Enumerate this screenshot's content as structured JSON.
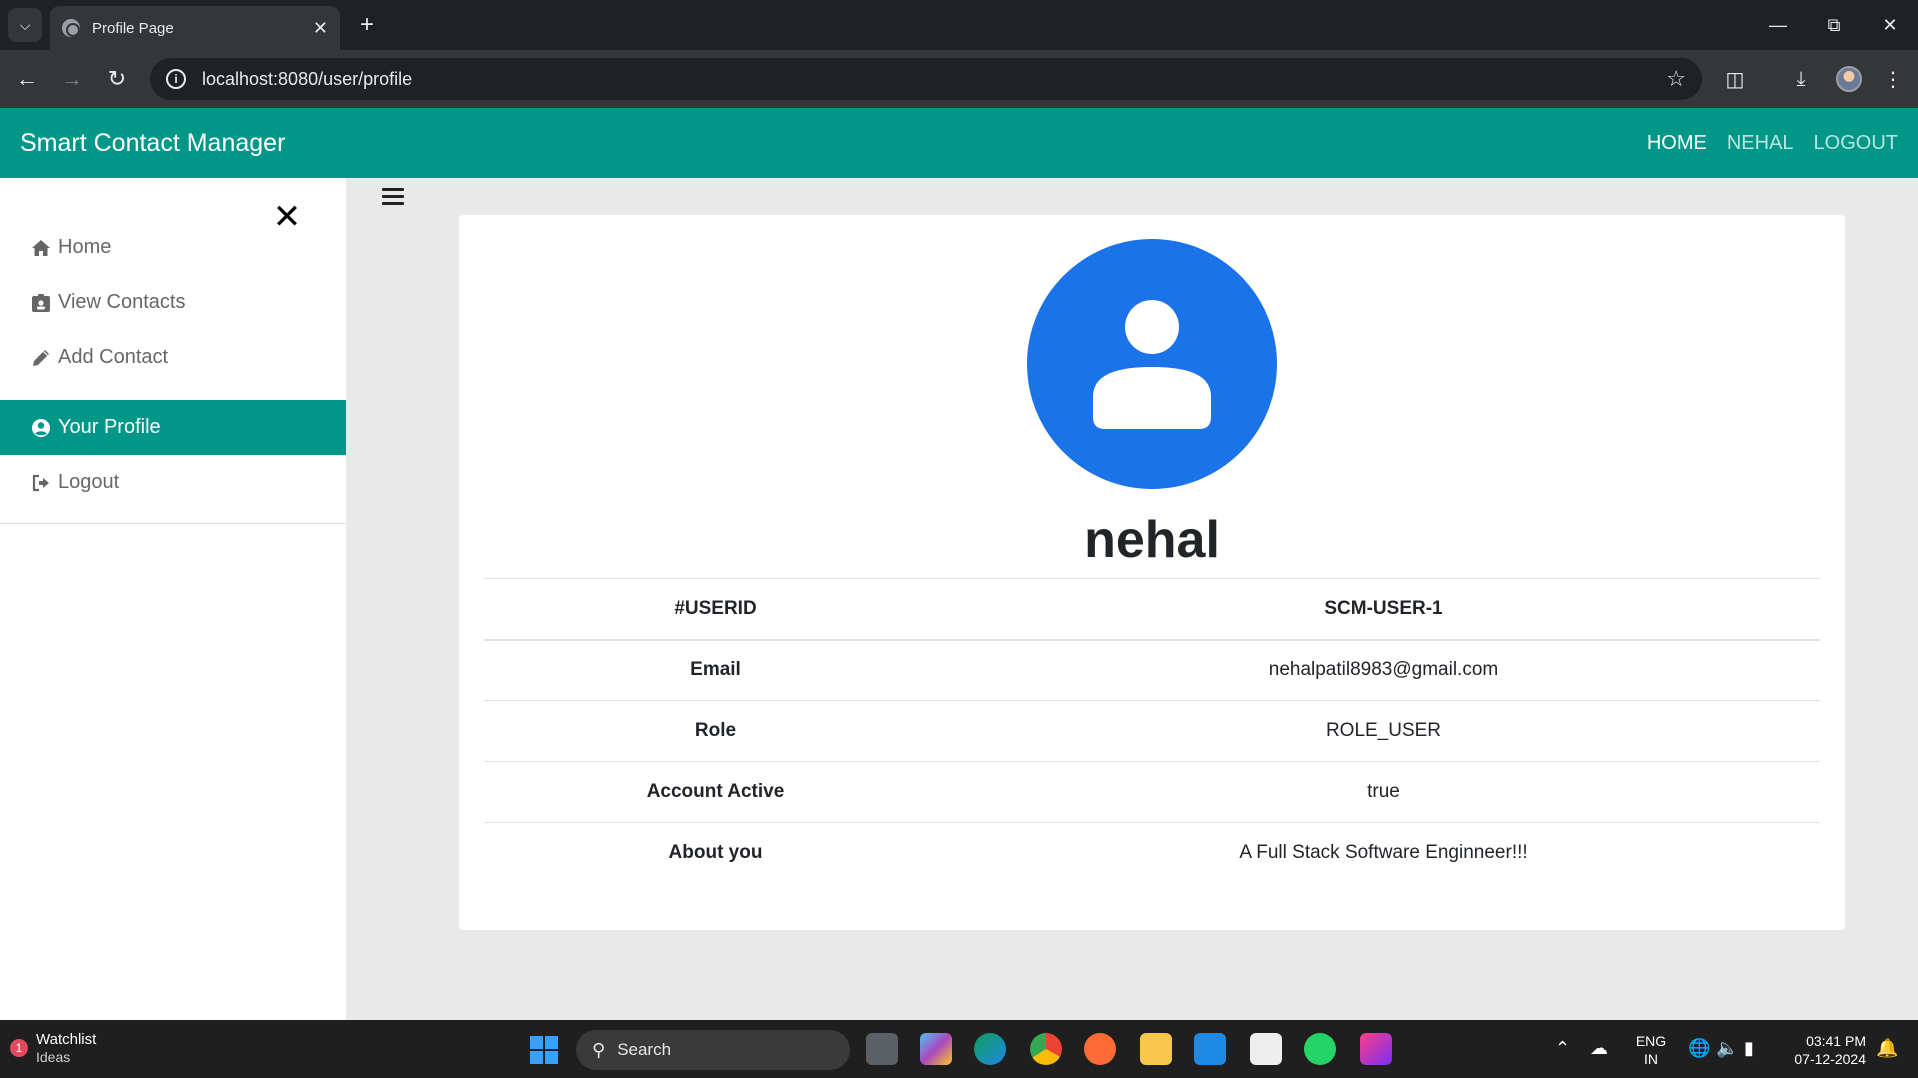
{
  "browser": {
    "tab_title": "Profile Page",
    "url": "localhost:8080/user/profile"
  },
  "app": {
    "brand": "Smart Contact Manager",
    "nav": [
      {
        "label": "HOME",
        "active": true
      },
      {
        "label": "NEHAL",
        "active": false
      },
      {
        "label": "LOGOUT",
        "active": false
      }
    ]
  },
  "sidebar": {
    "items": [
      {
        "label": "Home",
        "icon": "home-icon"
      },
      {
        "label": "View Contacts",
        "icon": "id-card-icon"
      },
      {
        "label": "Add Contact",
        "icon": "pencil-icon"
      },
      {
        "label": "Your Profile",
        "icon": "user-circle-icon",
        "active": true
      },
      {
        "label": "Logout",
        "icon": "sign-out-icon"
      }
    ]
  },
  "profile": {
    "name": "nehal",
    "rows": [
      {
        "key": "#USERID",
        "value": "SCM-USER-1"
      },
      {
        "key": "Email",
        "value": "nehalpatil8983@gmail.com"
      },
      {
        "key": "Role",
        "value": "ROLE_USER"
      },
      {
        "key": "Account Active",
        "value": "true"
      },
      {
        "key": "About you",
        "value": "A Full Stack Software Enginneer!!!"
      }
    ]
  },
  "taskbar": {
    "widget_badge": "1",
    "widget_title": "Watchlist",
    "widget_sub": "Ideas",
    "search_label": "Search",
    "lang_top": "ENG",
    "lang_bottom": "IN",
    "time": "03:41 PM",
    "date": "07-12-2024"
  },
  "colors": {
    "primary": "#009688",
    "avatar_blue": "#1a73e8"
  }
}
